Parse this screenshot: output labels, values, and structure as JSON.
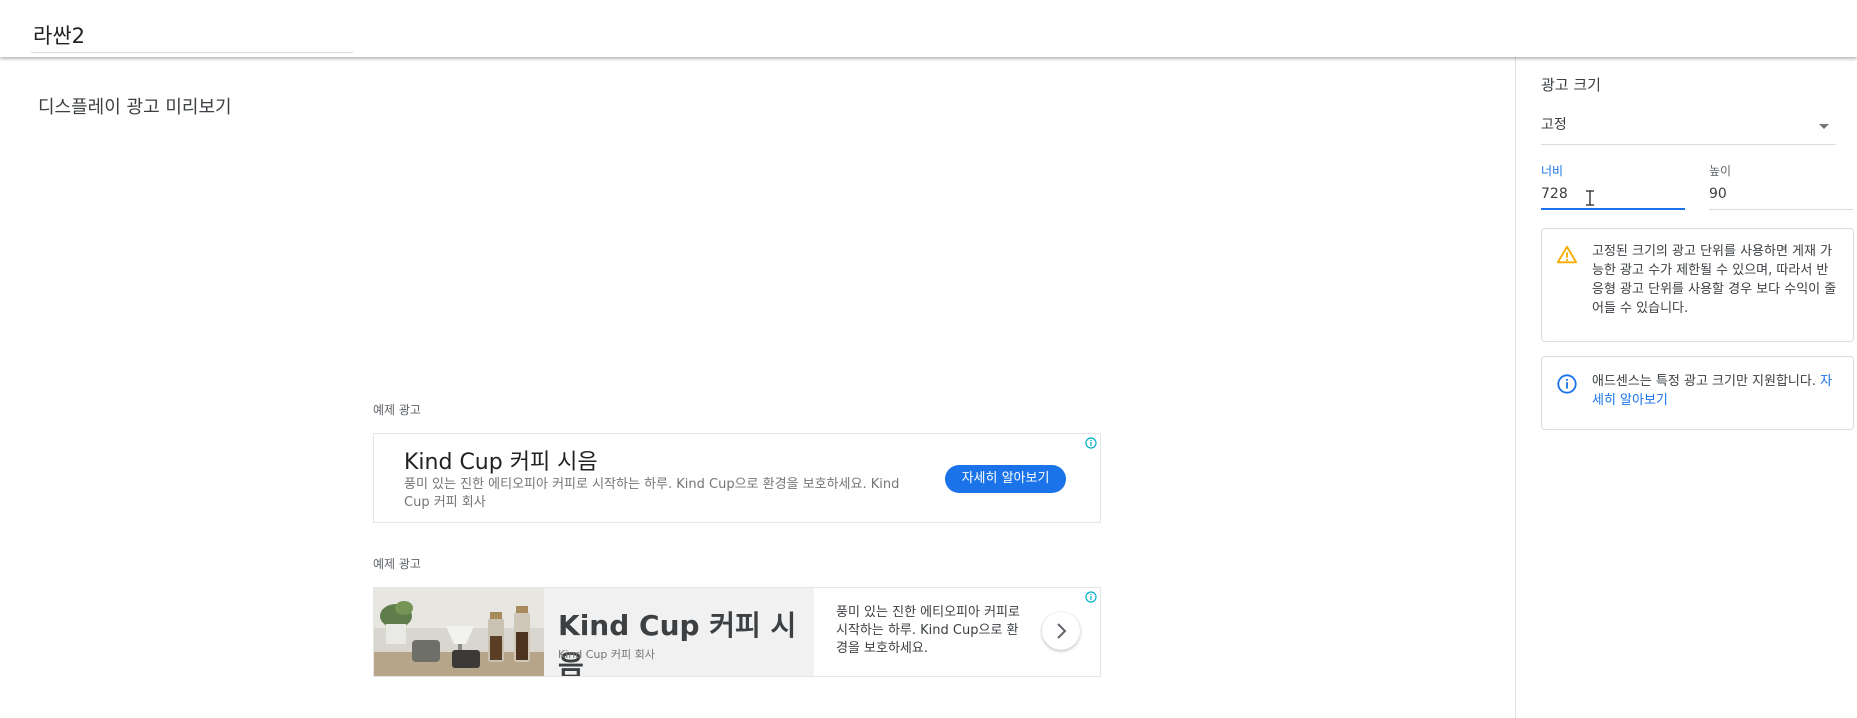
{
  "header": {
    "ad_unit_name": "라싼2"
  },
  "main": {
    "title": "디스플레이 광고 미리보기",
    "ads": [
      {
        "label": "예제 광고",
        "headline": "Kind Cup 커피 시음",
        "description": "풍미 있는 진한 에티오피아 커피로 시작하는 하루. Kind Cup으로 환경을 보호하세요. Kind Cup 커피 회사",
        "cta": "자세히 알아보기",
        "adchoices_icon": "info-icon"
      },
      {
        "label": "예제 광고",
        "headline": "Kind Cup 커피 시음",
        "brand": "Kind Cup 커피 회사",
        "description": "풍미 있는 진한 에티오피아 커피로 시작하는 하루. Kind Cup으로 환경을 보호하세요.",
        "next_icon": "chevron-right-icon",
        "adchoices_icon": "info-icon"
      }
    ]
  },
  "sidebar": {
    "section_title": "광고 크기",
    "size_type": {
      "value": "고정"
    },
    "width": {
      "label": "너비",
      "value": "728"
    },
    "height": {
      "label": "높이",
      "value": "90"
    },
    "warning": {
      "icon": "warning-icon",
      "text": "고정된 크기의 광고 단위를 사용하면 게재 가능한 광고 수가 제한될 수 있으며, 따라서 반응형 광고 단위를 사용할 경우 보다 수익이 줄어들 수 있습니다."
    },
    "info": {
      "icon": "info-icon",
      "text": "애드센스는 특정 광고 크기만 지원합니다.",
      "link": "자세히 알아보기"
    }
  },
  "colors": {
    "accent": "#1a73e8",
    "warning": "#f9ab00",
    "text": "#3c4043",
    "cta_bg": "#1a73e8"
  }
}
